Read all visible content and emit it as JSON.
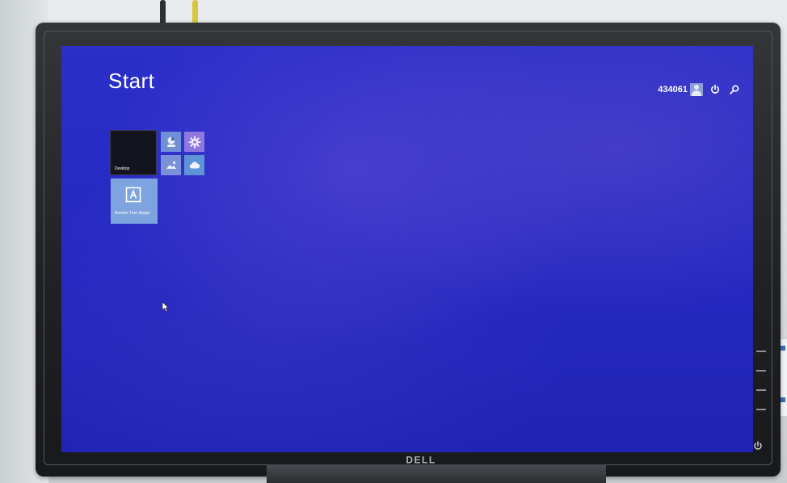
{
  "screen": {
    "title": "Start",
    "user": {
      "name": "434061",
      "icon": "user-avatar-icon"
    },
    "top_icons": [
      "power-icon",
      "search-icon"
    ]
  },
  "tiles": {
    "desktop": {
      "label": "Desktop",
      "color": "#14141e"
    },
    "people": {
      "icon": "people-icon",
      "color": "#6f8fd6"
    },
    "settings": {
      "icon": "settings-gear-icon",
      "color": "#8e78e0"
    },
    "photos": {
      "icon": "photos-icon",
      "color": "#7a91d8"
    },
    "skydrive": {
      "icon": "cloud-icon",
      "color": "#5f93d8"
    },
    "acronis": {
      "label": "Acronis True Image",
      "icon": "acronis-logo-icon",
      "color": "#7ea4e0"
    }
  },
  "monitor": {
    "brand": "DELL",
    "accent": "#2529c2"
  }
}
